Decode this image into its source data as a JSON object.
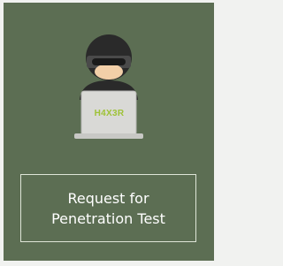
{
  "tile": {
    "laptop_text": "H4X3R",
    "label": "Request for\nPenetration Test",
    "icon": "hacker-laptop-icon"
  },
  "colors": {
    "tile_background": "#5c6e53",
    "laptop_text": "#9ec236",
    "label_border": "#dfe5d8"
  }
}
